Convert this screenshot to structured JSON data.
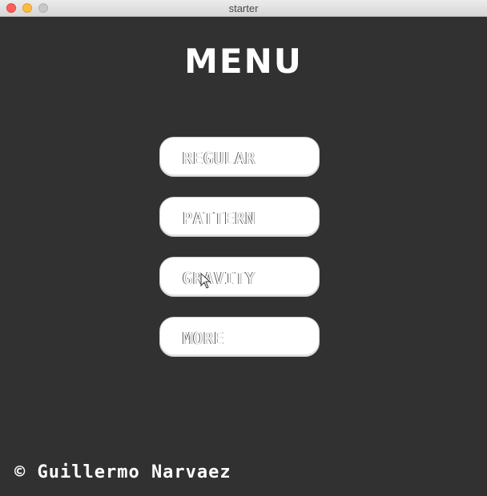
{
  "window": {
    "title": "starter"
  },
  "menu": {
    "title": "MENU",
    "buttons": [
      {
        "label": "REGULAR"
      },
      {
        "label": "PATTERN"
      },
      {
        "label": "GRAVITY"
      },
      {
        "label": "MORE"
      }
    ]
  },
  "footer": {
    "copyright": "© Guillermo Narvaez"
  },
  "icons": {
    "close": "close-dot",
    "minimize": "minimize-dot",
    "zoom": "zoom-dot",
    "cursor": "pointer-cursor"
  },
  "colors": {
    "background": "#313131",
    "button_bg": "#ffffff",
    "text": "#ffffff"
  }
}
